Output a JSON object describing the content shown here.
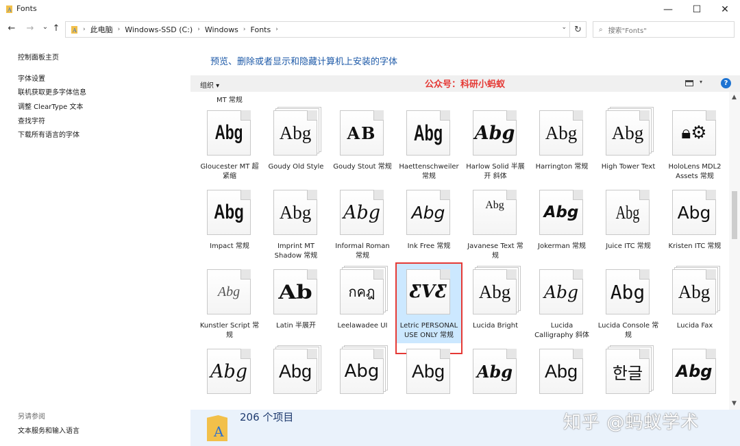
{
  "window": {
    "title": "Fonts",
    "minimize": "—",
    "maximize": "☐",
    "close": "✕"
  },
  "nav": {
    "back": "←",
    "forward": "→",
    "recent": "⌄",
    "up": "↑"
  },
  "address": {
    "crumbs": [
      "此电脑",
      "Windows-SSD (C:)",
      "Windows",
      "Fonts"
    ],
    "sep": "›",
    "dropdown": "⌄",
    "refresh": "↻"
  },
  "search": {
    "placeholder": "搜索\"Fonts\"",
    "icon": "⌕"
  },
  "sidebar": {
    "links": [
      "控制面板主页",
      "字体设置",
      "联机获取更多字体信息",
      "调整 ClearType 文本",
      "查找字符",
      "下载所有语言的字体"
    ],
    "see_also_title": "另请参阅",
    "see_also": [
      "文本服务和输入语言"
    ]
  },
  "main": {
    "heading": "预览、删除或者显示和隐藏计算机上安装的字体",
    "organize": "组织 ▾",
    "watermark": "公众号：科研小蚂蚁",
    "help": "?",
    "view_dropdown": "▾",
    "partial_label": "MT 常规",
    "rows": [
      [
        {
          "name": "Gloucester MT 超紧缩",
          "sample": "Abg",
          "stack": false
        },
        {
          "name": "Goudy Old Style",
          "sample": "Abg",
          "stack": true
        },
        {
          "name": "Goudy Stout 常规",
          "sample": "AB",
          "stack": false
        },
        {
          "name": "Haettenschweiler 常规",
          "sample": "Abg",
          "stack": false
        },
        {
          "name": "Harlow Solid 半展开 斜体",
          "sample": "Abg",
          "stack": false
        },
        {
          "name": "Harrington 常规",
          "sample": "Abg",
          "stack": false
        },
        {
          "name": "High Tower Text",
          "sample": "Abg",
          "stack": true
        },
        {
          "name": "HoloLens MDL2 Assets 常规",
          "sample": "🔒︎⚙",
          "stack": false
        }
      ],
      [
        {
          "name": "Impact 常规",
          "sample": "Abg",
          "stack": false
        },
        {
          "name": "Imprint MT Shadow 常规",
          "sample": "Abg",
          "stack": false
        },
        {
          "name": "Informal Roman 常规",
          "sample": "Abg",
          "stack": false
        },
        {
          "name": "Ink Free 常规",
          "sample": "Abg",
          "stack": false
        },
        {
          "name": "Javanese Text 常规",
          "sample": "Abg",
          "stack": false
        },
        {
          "name": "Jokerman 常规",
          "sample": "Abg",
          "stack": false
        },
        {
          "name": "Juice ITC 常规",
          "sample": "Abg",
          "stack": false
        },
        {
          "name": "Kristen ITC 常规",
          "sample": "Abg",
          "stack": false
        }
      ],
      [
        {
          "name": "Kunstler Script 常规",
          "sample": "Abg",
          "stack": false
        },
        {
          "name": "Latin 半展开",
          "sample": "Ab",
          "stack": false
        },
        {
          "name": "Leelawadee UI",
          "sample": "กคฎ",
          "stack": true
        },
        {
          "name": "Letric PERSONAL USE ONLY 常规",
          "sample": "ƸVƸ",
          "stack": false,
          "selected": true
        },
        {
          "name": "Lucida Bright",
          "sample": "Abg",
          "stack": true
        },
        {
          "name": "Lucida Calligraphy 斜体",
          "sample": "Abg",
          "stack": false
        },
        {
          "name": "Lucida Console 常规",
          "sample": "Abg",
          "stack": false
        },
        {
          "name": "Lucida Fax",
          "sample": "Abg",
          "stack": true
        }
      ],
      [
        {
          "name": "",
          "sample": "Abg",
          "stack": false
        },
        {
          "name": "",
          "sample": "Abg",
          "stack": true
        },
        {
          "name": "",
          "sample": "Abg",
          "stack": true
        },
        {
          "name": "",
          "sample": "Abg",
          "stack": false
        },
        {
          "name": "",
          "sample": "Abg",
          "stack": false
        },
        {
          "name": "",
          "sample": "Abg",
          "stack": false
        },
        {
          "name": "",
          "sample": "한글",
          "stack": true
        },
        {
          "name": "",
          "sample": "Abg",
          "stack": false
        }
      ]
    ]
  },
  "status": {
    "count": "206 个项目",
    "site_watermark": "知乎 @蚂蚁学术",
    "folder_letter": "A"
  }
}
